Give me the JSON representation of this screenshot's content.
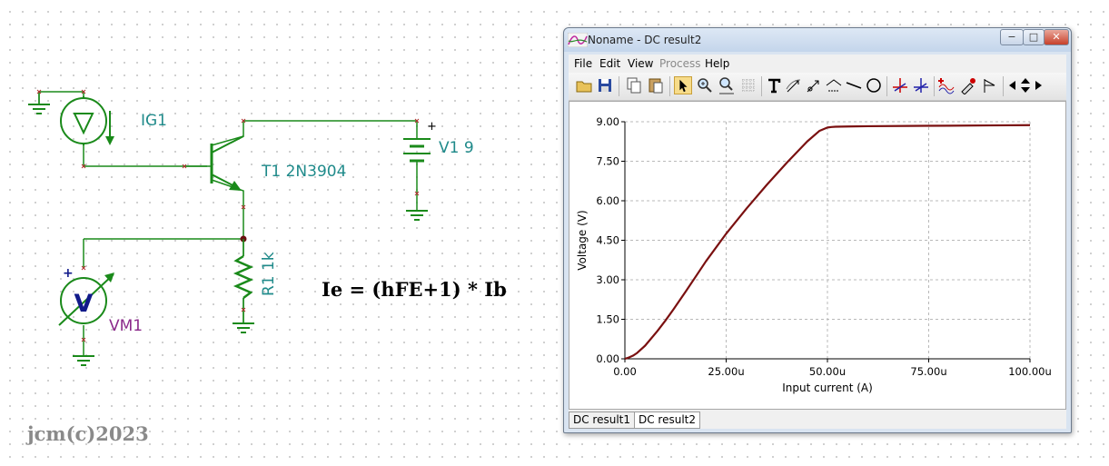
{
  "schematic": {
    "ig1_label": "IG1",
    "t1_label": "T1 2N3904",
    "v1_label": "V1 9",
    "r1_label": "R1 1k",
    "vm1_label": "VM1",
    "voltmeter_symbol": "V",
    "plus_sign": "+",
    "formula": "Ie = (hFE+1) * Ib",
    "copyright": "jcm(c)2023",
    "colors": {
      "wire": "#1a8a1a",
      "label": "#1f8a8a",
      "meter_label": "#8b2a8b",
      "node_marker": "#a01010"
    }
  },
  "window": {
    "title": "Noname - DC result2",
    "controls": {
      "minimize": "−",
      "maximize": "□",
      "close": "✕"
    },
    "menu": [
      {
        "label": "File",
        "enabled": true
      },
      {
        "label": "Edit",
        "enabled": true
      },
      {
        "label": "View",
        "enabled": true
      },
      {
        "label": "Process",
        "enabled": false
      },
      {
        "label": "Help",
        "enabled": true
      }
    ],
    "toolbar_icons": [
      "open-folder-icon",
      "save-icon",
      "copy-icon",
      "paste-icon",
      "pointer-icon",
      "zoom-in-icon",
      "zoom-100-icon",
      "grid-icon",
      "text-icon",
      "curve-tool-icon",
      "curve-tool-2-icon",
      "curve-tool-3-icon",
      "line-icon",
      "circle-icon",
      "cursor-a-icon",
      "cursor-b-icon",
      "add-curve-icon",
      "pipette-icon",
      "flag-icon",
      "scroll-left-icon",
      "scroll-updown-icon",
      "scroll-right-icon"
    ],
    "tabs": [
      {
        "label": "DC result1",
        "active": false
      },
      {
        "label": "DC result2",
        "active": true
      }
    ]
  },
  "chart_data": {
    "type": "line",
    "title": "",
    "xlabel": "Input current (A)",
    "ylabel": "Voltage (V)",
    "xlim": [
      0,
      100
    ],
    "ylim": [
      0,
      9
    ],
    "x_ticks": [
      0,
      25,
      50,
      75,
      100
    ],
    "x_tick_labels": [
      "0.00",
      "25.00u",
      "50.00u",
      "75.00u",
      "100.00u"
    ],
    "y_ticks": [
      0,
      1.5,
      3,
      4.5,
      6,
      7.5,
      9
    ],
    "y_tick_labels": [
      "0.00",
      "1.50",
      "3.00",
      "4.50",
      "6.00",
      "7.50",
      "9.00"
    ],
    "grid": true,
    "line_color": "#7a1010",
    "series": [
      {
        "x": [
          0,
          1,
          2,
          3,
          5,
          8,
          10,
          12,
          15,
          20,
          25,
          30,
          35,
          40,
          45,
          48,
          50,
          51,
          52,
          55,
          60,
          70,
          80,
          90,
          100
        ],
        "y": [
          0,
          0.05,
          0.12,
          0.22,
          0.5,
          1.05,
          1.45,
          1.88,
          2.55,
          3.7,
          4.75,
          5.7,
          6.6,
          7.45,
          8.25,
          8.65,
          8.78,
          8.8,
          8.81,
          8.82,
          8.83,
          8.84,
          8.85,
          8.86,
          8.87
        ]
      }
    ]
  }
}
